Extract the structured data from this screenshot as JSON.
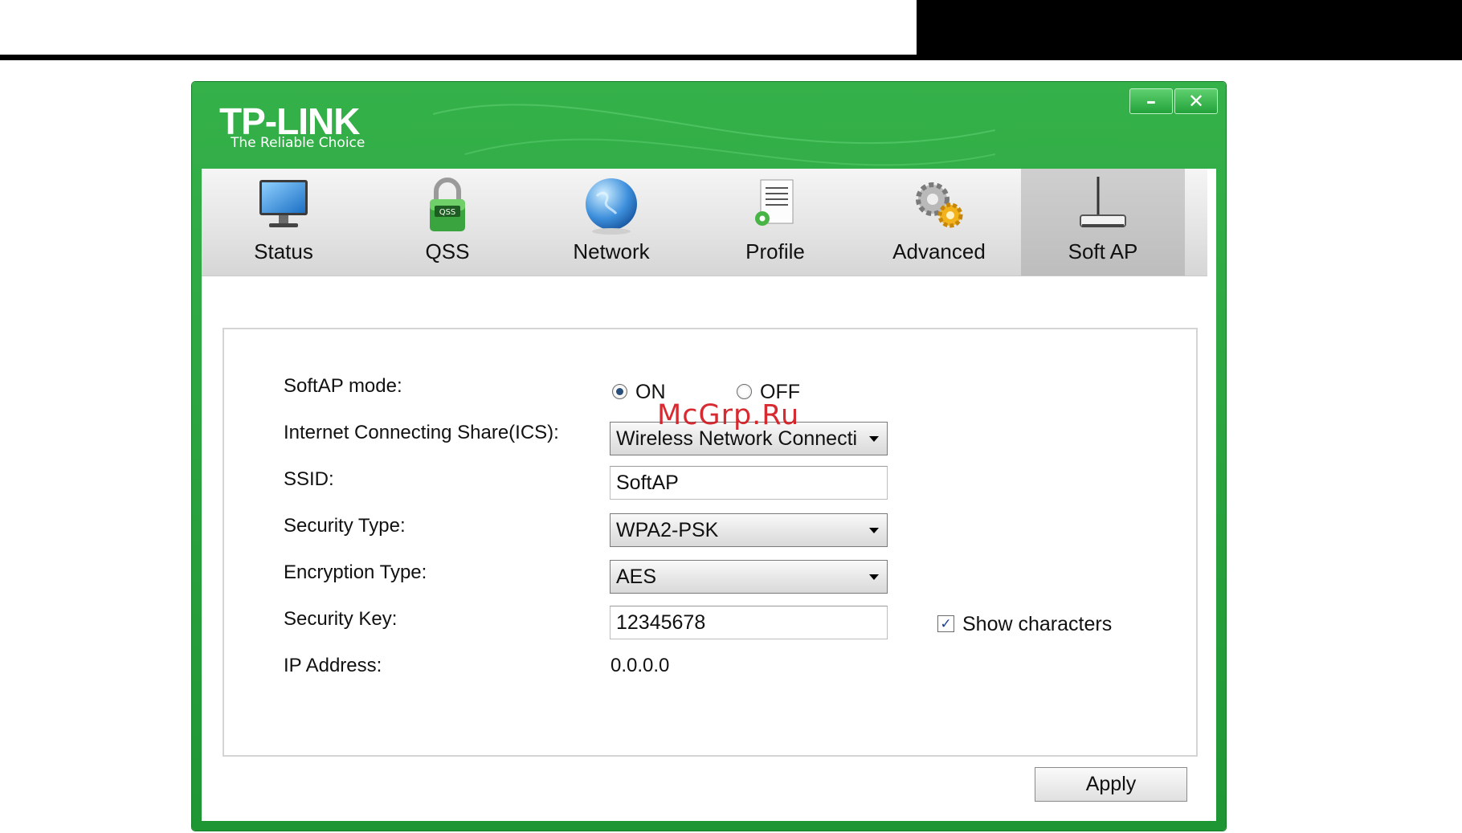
{
  "app": {
    "logo": "TP-LINK",
    "tagline": "The Reliable Choice",
    "window_buttons": {
      "minimize": "–",
      "close": "✕"
    }
  },
  "tabs": [
    {
      "label": "Status",
      "icon": "monitor-icon"
    },
    {
      "label": "QSS",
      "icon": "padlock-icon"
    },
    {
      "label": "Network",
      "icon": "globe-icon"
    },
    {
      "label": "Profile",
      "icon": "document-icon"
    },
    {
      "label": "Advanced",
      "icon": "gears-icon"
    },
    {
      "label": "Soft AP",
      "icon": "router-icon",
      "active": true
    }
  ],
  "form": {
    "softap_mode_label": "SoftAP mode:",
    "softap_on": "ON",
    "softap_off": "OFF",
    "softap_selected": "ON",
    "ics_label": "Internet Connecting Share(ICS):",
    "ics_value": "Wireless Network Connecti",
    "ssid_label": "SSID:",
    "ssid_value": "SoftAP",
    "security_type_label": "Security Type:",
    "security_type_value": "WPA2-PSK",
    "encryption_type_label": "Encryption Type:",
    "encryption_type_value": "AES",
    "security_key_label": "Security Key:",
    "security_key_value": "12345678",
    "show_characters_label": "Show characters",
    "show_characters_checked": true,
    "ip_label": "IP Address:",
    "ip_value": "0.0.0.0"
  },
  "apply_label": "Apply",
  "watermark": "McGrp.Ru",
  "colors": {
    "brand_green": "#2aa540",
    "accent_blue": "#2a4e7a"
  }
}
